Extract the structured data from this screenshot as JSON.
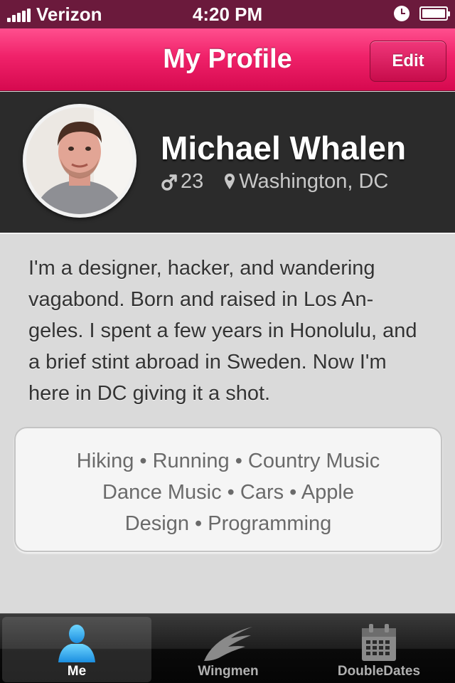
{
  "status_bar": {
    "carrier": "Verizon",
    "time": "4:20 PM",
    "icons": [
      "signal-bars-icon",
      "clock-icon",
      "battery-icon"
    ]
  },
  "nav": {
    "title": "My Profile",
    "edit_label": "Edit",
    "color": "#f0226a"
  },
  "profile": {
    "name": "Michael Whalen",
    "gender_icon": "male-symbol-icon",
    "age": "23",
    "location_icon": "map-pin-icon",
    "location": "Washington, DC"
  },
  "bio": "I'm a designer, hacker, and wandering vagabond. Born and raised in Los An-geles. I spent a few years in Honolulu, and a brief stint abroad in Sweden. Now I'm here in DC giving it a shot.",
  "interests": {
    "lines": [
      "Hiking • Running • Country Music",
      "Dance Music • Cars • Apple",
      "Design • Programming"
    ]
  },
  "tabs": [
    {
      "label": "Me",
      "icon": "person-icon",
      "active": true
    },
    {
      "label": "Wingmen",
      "icon": "wing-icon",
      "active": false
    },
    {
      "label": "DoubleDates",
      "icon": "calendar-icon",
      "active": false
    }
  ]
}
